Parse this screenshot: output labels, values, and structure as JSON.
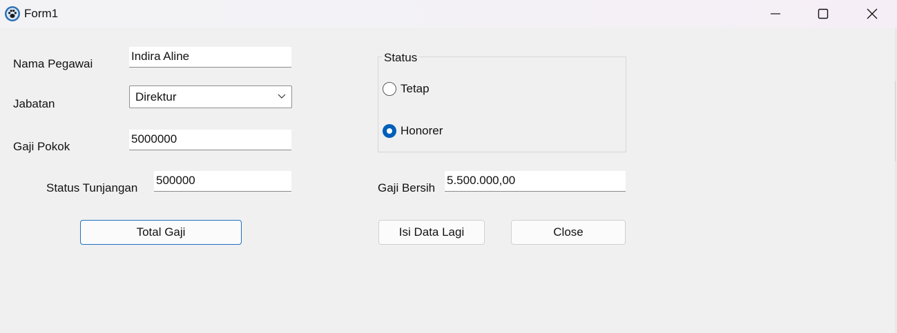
{
  "window": {
    "title": "Form1",
    "controls": [
      "minimize",
      "maximize",
      "close"
    ]
  },
  "form": {
    "nama_pegawai": {
      "label": "Nama Pegawai",
      "value": "Indira Aline"
    },
    "jabatan": {
      "label": "Jabatan",
      "selected": "Direktur"
    },
    "gaji_pokok": {
      "label": "Gaji Pokok",
      "value": "5000000"
    },
    "status_tunjangan": {
      "label": "Status Tunjangan",
      "value": "500000"
    },
    "gaji_bersih": {
      "label": "Gaji Bersih",
      "value": "5.500.000,00"
    },
    "status": {
      "title": "Status",
      "options": [
        {
          "label": "Tetap",
          "checked": false
        },
        {
          "label": "Honorer",
          "checked": true
        }
      ]
    }
  },
  "buttons": {
    "total_gaji": "Total Gaji",
    "isi_data_lagi": "Isi Data Lagi",
    "close": "Close"
  },
  "colors": {
    "background": "#f0f0f0",
    "accent": "#005fb8",
    "primary_button_border": "#1f6fbf"
  }
}
